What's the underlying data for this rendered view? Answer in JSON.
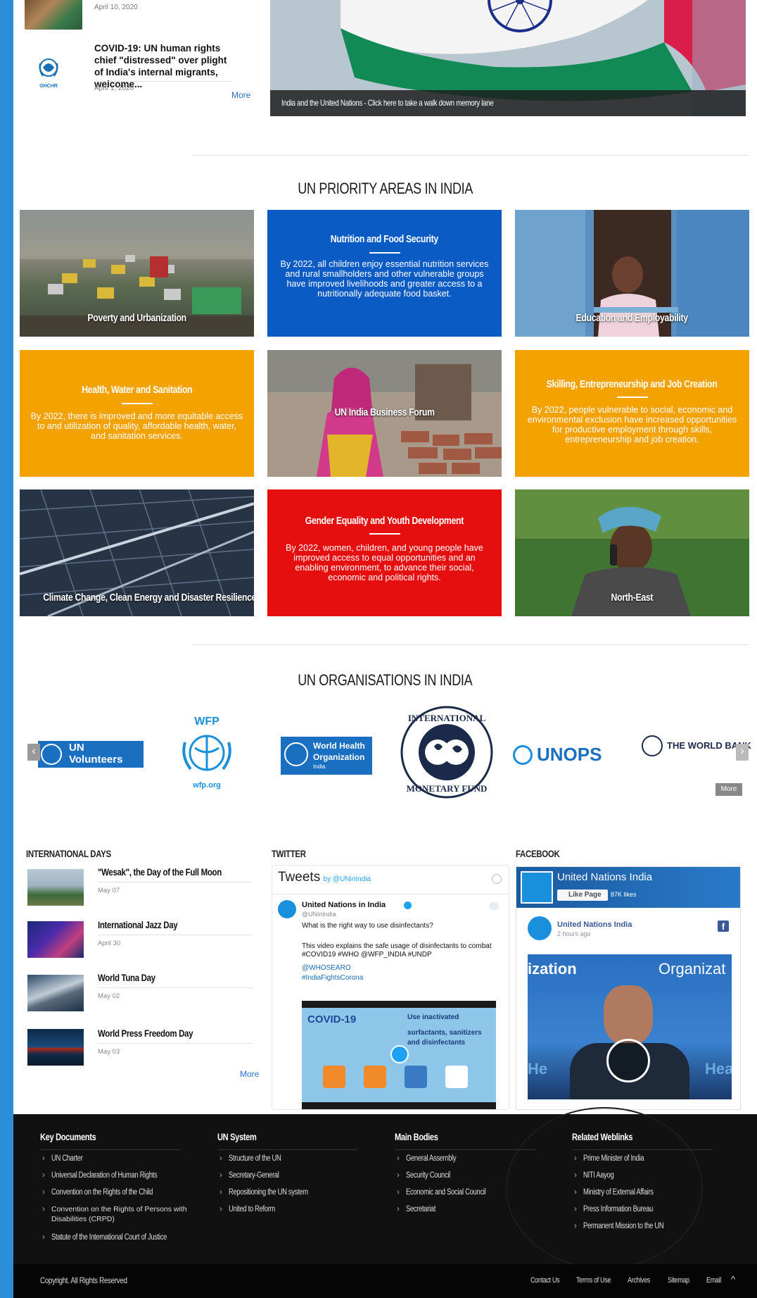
{
  "news": {
    "item1_date": "April 10, 2020",
    "item2_title": "COVID-19: UN human rights chief \"distressed\" over plight of India's internal migrants, welcome...",
    "item2_date": "April 1, 2020",
    "more": "More",
    "org_logo_text": "OHCHR",
    "hero_caption": "India and the United Nations - Click here to take a walk down memory lane"
  },
  "priority": {
    "heading": "UN PRIORITY AREAS IN INDIA",
    "tiles": [
      {
        "label": "Poverty and Urbanization"
      },
      {
        "title": "Nutrition and Food Security",
        "text": "By 2022, all children enjoy essential nutrition services and rural smallholders and other vulnerable groups have improved livelihoods and greater access to a nutritionally adequate food basket."
      },
      {
        "label": "Education and Employability"
      },
      {
        "title": "Health, Water and Sanitation",
        "text": "By 2022, there is improved and more equitable access to and utilization of quality, affordable health, water, and sanitation services."
      },
      {
        "label": "UN India Business Forum"
      },
      {
        "title": "Skilling, Entrepreneurship and Job Creation",
        "text": "By 2022, people vulnerable to social, economic and environmental exclusion have increased opportunities for productive employment through skills, entrepreneurship and job creation."
      },
      {
        "label": "Climate Change, Clean Energy and Disaster Resilience"
      },
      {
        "title": "Gender Equality and Youth Development",
        "text": "By 2022, women, children, and young people have improved access to equal opportunities and an enabling environment, to advance their social, economic and political rights."
      },
      {
        "label": "North-East"
      }
    ]
  },
  "orgs": {
    "heading": "UN ORGANISATIONS IN INDIA",
    "unv_un": "UN",
    "unv_name": "Volunteers",
    "wfp": "WFP",
    "wfp_url": "wfp.org",
    "who_line1": "World Health",
    "who_line2": "Organization",
    "who_region": "India",
    "imf_top": "INTERNATIONAL",
    "imf_bottom": "MONETARY FUND",
    "unops": "UNOPS",
    "worldbank": "THE WORLD BANK",
    "prev": "‹",
    "next": "›",
    "more": "More"
  },
  "intl_days": {
    "heading": "INTERNATIONAL DAYS",
    "items": [
      {
        "title": "\"Wesak\", the Day of the Full Moon",
        "date": "May 07"
      },
      {
        "title": "International Jazz Day",
        "date": "April 30"
      },
      {
        "title": "World Tuna Day",
        "date": "May 02"
      },
      {
        "title": "World Press Freedom Day",
        "date": "May 03"
      }
    ],
    "more": "More"
  },
  "twitter": {
    "heading": "TWITTER",
    "header_tweets": "Tweets",
    "header_by": "by @UNinIndia",
    "account_name": "United Nations in India",
    "handle": "@UNinIndia",
    "text1": "What is the right way to use disinfectants?",
    "text2": "This video explains the safe usage of disinfectants to combat #COVID19 #WHO @WFP_INDIA #UNDP",
    "text3": "@WHOSEARO",
    "text4": "#IndiaFightsCorona",
    "video_title": "COVID-19",
    "video_text1": "Use inactivated",
    "video_text2": "surfactants, sanitizers",
    "video_text3": "and disinfectants"
  },
  "facebook": {
    "heading": "FACEBOOK",
    "page_name": "United Nations India",
    "like_label": "Like Page",
    "likes_count": "87K likes",
    "post_name": "United Nations India",
    "post_time": "2 hours ago",
    "video_text_left": "ization",
    "video_text_right": "Organizat",
    "video_bottom_left": "He",
    "video_bottom_right": "Hea"
  },
  "footer": {
    "cols": [
      {
        "heading": "Key Documents",
        "items": [
          "UN Charter",
          "Universal Declaration of Human Rights",
          "Convention on the Rights of the Child",
          "Convention on the Rights of Persons with Disabilities (CRPD)",
          "Statute of the International Court of Justice"
        ]
      },
      {
        "heading": "UN System",
        "items": [
          "Structure of the UN",
          "Secretary-General",
          "Repositioning the UN system",
          "United to Reform"
        ]
      },
      {
        "heading": "Main Bodies",
        "items": [
          "General Assembly",
          "Security Council",
          "Economic and Social Council",
          "Secretariat"
        ]
      },
      {
        "heading": "Related Weblinks",
        "items": [
          "Prime Minister of India",
          "NITI Aayog",
          "Ministry of External Affairs",
          "Press Information Bureau",
          "Permanent Mission to the UN"
        ]
      }
    ],
    "copyright": "Copyright. All Rights Reserved",
    "links": [
      "Contact Us",
      "Terms of Use",
      "Archives",
      "Sitemap",
      "Email"
    ],
    "up_arrow": "^"
  },
  "colors": {
    "blue_tile": "#0b5bc4",
    "orange_tile": "#f3a200",
    "red_tile": "#e60f0f",
    "un_blue": "#1a8fdc",
    "footer_bg": "#111111"
  }
}
